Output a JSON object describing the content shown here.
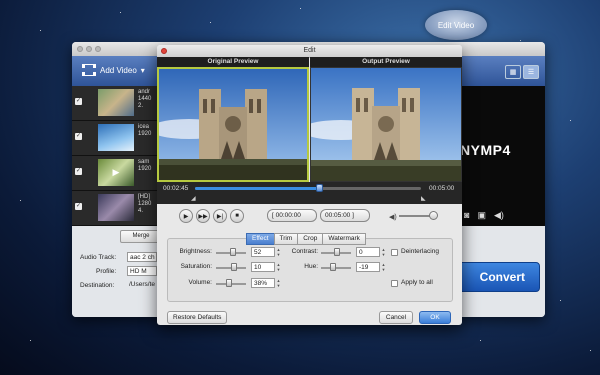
{
  "callout": {
    "label": "Edit Video"
  },
  "main_window": {
    "toolbar": {
      "add_video_label": "Add Video",
      "dropdown_arrow": "▾"
    },
    "files": [
      {
        "line1": "andr",
        "line2": "1440",
        "line3": "2."
      },
      {
        "line1": "icea",
        "line2": "1920",
        "line3": ""
      },
      {
        "line1": "sam",
        "line2": "1920",
        "line3": ""
      },
      {
        "line1": "[HD]",
        "line2": "1280",
        "line3": "4."
      }
    ],
    "brand_text": "NYMP4",
    "merge_label": "Merge",
    "audio_track_label": "Audio Track:",
    "audio_track_value": "aac 2 ch",
    "profile_label": "Profile:",
    "profile_value": "HD M",
    "destination_label": "Destination:",
    "destination_value": "/Users/te",
    "convert_label": "Convert"
  },
  "edit_dialog": {
    "title": "Edit",
    "original_preview_label": "Original Preview",
    "output_preview_label": "Output Preview",
    "time_current": "00:02:45",
    "time_total": "00:05:00",
    "playback_progress": 0.55,
    "start_time": "00:00:00",
    "end_time": "00:05:00",
    "tabs": [
      "Effect",
      "Trim",
      "Crop",
      "Watermark"
    ],
    "active_tab": "Effect",
    "brightness_label": "Brightness:",
    "brightness_value": "52",
    "saturation_label": "Saturation:",
    "saturation_value": "10",
    "volume_label": "Volume:",
    "volume_value": "38%",
    "contrast_label": "Contrast:",
    "contrast_value": "0",
    "hue_label": "Hue:",
    "hue_value": "-19",
    "deinterlacing_label": "Deinterlacing",
    "apply_all_label": "Apply to all",
    "restore_label": "Restore Defaults",
    "cancel_label": "Cancel",
    "ok_label": "OK"
  },
  "colors": {
    "accent": "#3a7ed8",
    "selection_border": "#b6c940",
    "toolbar": "#2f5498"
  }
}
